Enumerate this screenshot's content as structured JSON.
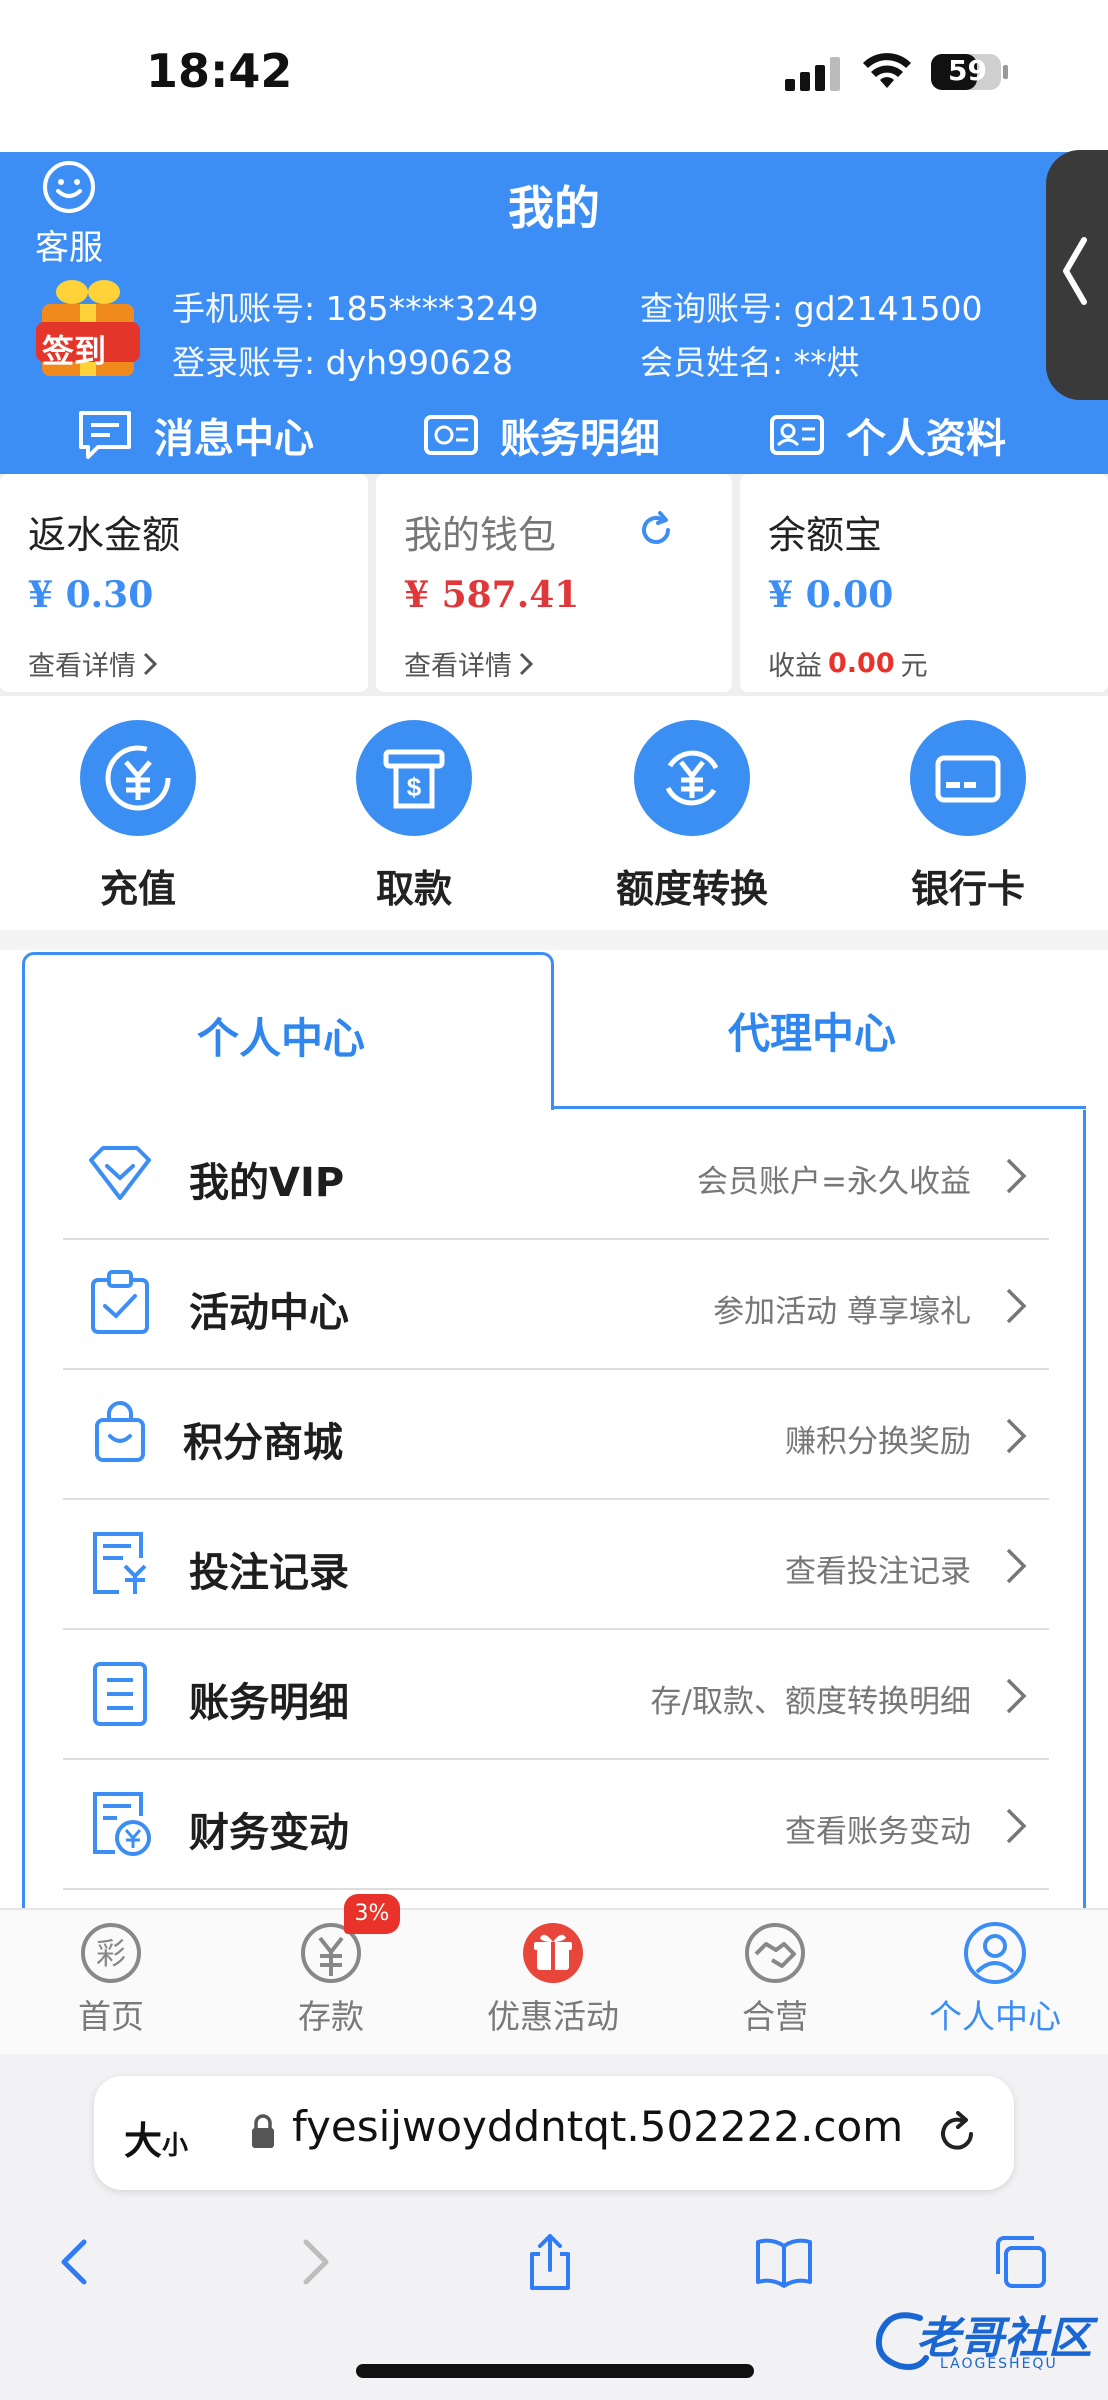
{
  "status": {
    "time": "18:42",
    "battery": "59"
  },
  "header": {
    "customer_service": "客服",
    "title": "我的",
    "signin_badge": "签到",
    "phone_label": "手机账号:",
    "phone_value": "185****3249",
    "query_label": "查询账号:",
    "query_value": "gd2141500",
    "login_label": "登录账号:",
    "login_value": "dyh990628",
    "member_label": "会员姓名:",
    "member_value": "**烘",
    "nav": [
      "消息中心",
      "账务明细",
      "个人资料"
    ]
  },
  "cards": {
    "rebate": {
      "title": "返水金额",
      "value": "¥ 0.30",
      "link": "查看详情"
    },
    "wallet": {
      "title": "我的钱包",
      "value": "¥ 587.41",
      "link": "查看详情"
    },
    "yuebao": {
      "title": "余额宝",
      "value": "¥ 0.00",
      "earn_label": "收益",
      "earn_value": "0.00",
      "earn_unit": "元"
    }
  },
  "actions": [
    "充值",
    "取款",
    "额度转换",
    "银行卡"
  ],
  "tabs": {
    "active": "个人中心",
    "inactive": "代理中心"
  },
  "menu": [
    {
      "name": "我的VIP",
      "desc": "会员账户=永久收益"
    },
    {
      "name": "活动中心",
      "desc": "参加活动 尊享壕礼"
    },
    {
      "name": "积分商城",
      "desc": "赚积分换奖励"
    },
    {
      "name": "投注记录",
      "desc": "查看投注记录"
    },
    {
      "name": "账务明细",
      "desc": "存/取款、额度转换明细"
    },
    {
      "name": "财务变动",
      "desc": "查看账务变动"
    }
  ],
  "tabbar": {
    "items": [
      "首页",
      "存款",
      "优惠活动",
      "合营",
      "个人中心"
    ],
    "deposit_badge": "3%"
  },
  "browser": {
    "text_size": "大",
    "text_size_small": "小",
    "url": "fyesijwoyddntqt.502222.com"
  },
  "watermark": {
    "text": "老哥社区",
    "sub": "LAOGESHEQU"
  },
  "colors": {
    "brand_blue": "#3d8ef4",
    "accent_red": "#e8322a",
    "value_blue": "#2f86ee"
  }
}
